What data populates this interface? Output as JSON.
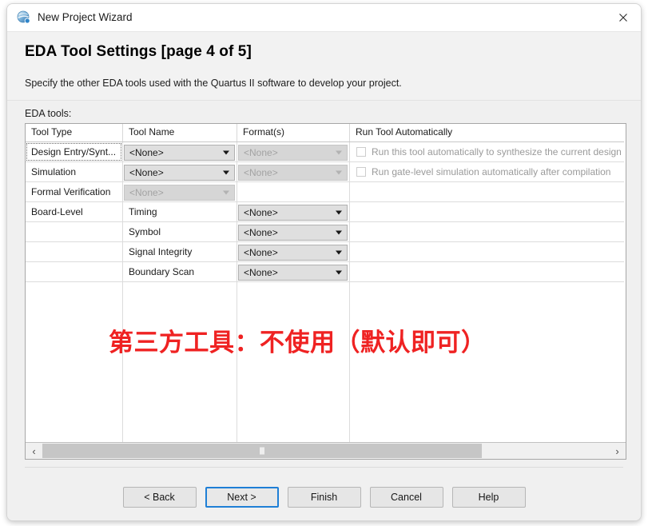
{
  "window": {
    "title": "New Project Wizard",
    "icon": "quartus-globe-icon",
    "close_label": "✕"
  },
  "header": {
    "title": "EDA Tool Settings [page 4 of 5]",
    "subtitle": "Specify the other EDA tools used with the Quartus II software to develop your project."
  },
  "body": {
    "eda_tools_label": "EDA tools:"
  },
  "table": {
    "columns": [
      "Tool Type",
      "Tool Name",
      "Format(s)",
      "Run Tool Automatically"
    ],
    "rows": [
      {
        "tool_type": "Design Entry/Synt...",
        "tool_type_focused": true,
        "tool_name": "<None>",
        "tool_name_disabled": false,
        "format": "<None>",
        "format_disabled": true,
        "run_auto": "Run this tool automatically to synthesize the current design",
        "run_auto_checked": false,
        "has_checkbox": true
      },
      {
        "tool_type": "Simulation",
        "tool_type_focused": false,
        "tool_name": "<None>",
        "tool_name_disabled": false,
        "format": "<None>",
        "format_disabled": true,
        "run_auto": "Run gate-level simulation automatically after compilation",
        "run_auto_checked": false,
        "has_checkbox": true
      },
      {
        "tool_type": "Formal Verification",
        "tool_type_focused": false,
        "tool_name": "<None>",
        "tool_name_disabled": true,
        "format": "",
        "format_disabled": null,
        "run_auto": "",
        "has_checkbox": false
      },
      {
        "tool_type": "Board-Level",
        "tool_type_focused": false,
        "tool_name": "Timing",
        "tool_name_plain": true,
        "format": "<None>",
        "format_disabled": false,
        "run_auto": "",
        "has_checkbox": false
      },
      {
        "tool_type": "",
        "tool_type_focused": false,
        "tool_name": "Symbol",
        "tool_name_plain": true,
        "format": "<None>",
        "format_disabled": false,
        "run_auto": "",
        "has_checkbox": false
      },
      {
        "tool_type": "",
        "tool_type_focused": false,
        "tool_name": "Signal Integrity",
        "tool_name_plain": true,
        "format": "<None>",
        "format_disabled": false,
        "run_auto": "",
        "has_checkbox": false
      },
      {
        "tool_type": "",
        "tool_type_focused": false,
        "tool_name": "Boundary Scan",
        "tool_name_plain": true,
        "format": "<None>",
        "format_disabled": false,
        "run_auto": "",
        "has_checkbox": false
      }
    ]
  },
  "annotation": {
    "text": "第三方工具：不使用（默认即可）",
    "color": "#ef2222"
  },
  "scrollbar": {
    "left_arrow": "‹",
    "right_arrow": "›"
  },
  "footer": {
    "buttons": [
      {
        "label": "< Back",
        "default": false
      },
      {
        "label": "Next >",
        "default": true
      },
      {
        "label": "Finish",
        "default": false
      },
      {
        "label": "Cancel",
        "default": false
      },
      {
        "label": "Help",
        "default": false
      }
    ]
  }
}
